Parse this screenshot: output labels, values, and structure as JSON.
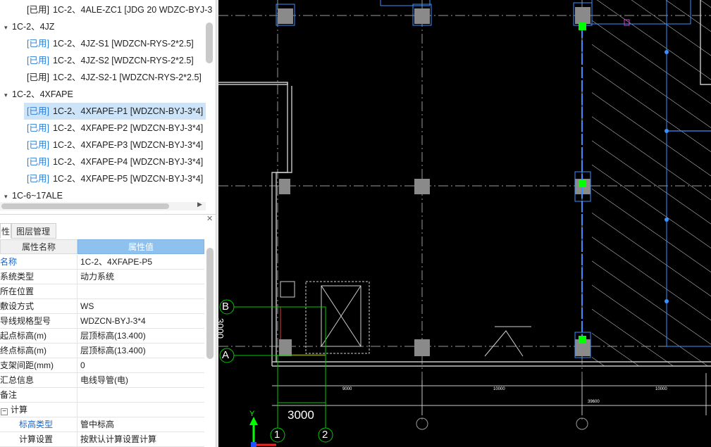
{
  "tree": {
    "rows": [
      {
        "kind": "leaf",
        "tag": "[已用]",
        "tag_color": "black",
        "label": "1C-2、4ALE-ZC1 [JDG 20 WDZC-BYJ-3"
      },
      {
        "kind": "group",
        "label": "1C-2、4JZ"
      },
      {
        "kind": "leaf",
        "tag": "[已用]",
        "tag_color": "blue",
        "label": "1C-2、4JZ-S1 [WDZCN-RYS-2*2.5]"
      },
      {
        "kind": "leaf",
        "tag": "[已用]",
        "tag_color": "blue",
        "label": "1C-2、4JZ-S2 [WDZCN-RYS-2*2.5]"
      },
      {
        "kind": "leaf",
        "tag": "[已用]",
        "tag_color": "black",
        "label": "1C-2、4JZ-S2-1 [WDZCN-RYS-2*2.5]"
      },
      {
        "kind": "group",
        "label": "1C-2、4XFAPE"
      },
      {
        "kind": "leaf",
        "tag": "[已用]",
        "tag_color": "blue",
        "label": "1C-2、4XFAPE-P1 [WDZCN-BYJ-3*4]",
        "selected": true
      },
      {
        "kind": "leaf",
        "tag": "[已用]",
        "tag_color": "blue",
        "label": "1C-2、4XFAPE-P2 [WDZCN-BYJ-3*4]"
      },
      {
        "kind": "leaf",
        "tag": "[已用]",
        "tag_color": "blue",
        "label": "1C-2、4XFAPE-P3 [WDZCN-BYJ-3*4]"
      },
      {
        "kind": "leaf",
        "tag": "[已用]",
        "tag_color": "blue",
        "label": "1C-2、4XFAPE-P4 [WDZCN-BYJ-3*4]"
      },
      {
        "kind": "leaf",
        "tag": "[已用]",
        "tag_color": "blue",
        "label": "1C-2、4XFAPE-P5 [WDZCN-BYJ-3*4]"
      },
      {
        "kind": "group",
        "label": "1C-6~17ALE"
      }
    ]
  },
  "properties": {
    "tabs": {
      "props": "性",
      "layers": "图层管理"
    },
    "header": {
      "name": "属性名称",
      "value": "属性值"
    },
    "rows": [
      {
        "name": "名称",
        "value": "1C-2、4XFAPE-P5",
        "blue": true
      },
      {
        "name": "系统类型",
        "value": "动力系统"
      },
      {
        "name": "所在位置",
        "value": ""
      },
      {
        "name": "敷设方式",
        "value": "WS"
      },
      {
        "name": "导线规格型号",
        "value": "WDZCN-BYJ-3*4"
      },
      {
        "name": "起点标高(m)",
        "value": "层顶标高(13.400)"
      },
      {
        "name": "终点标高(m)",
        "value": "层顶标高(13.400)"
      },
      {
        "name": "支架间距(mm)",
        "value": "0"
      },
      {
        "name": "汇总信息",
        "value": "电线导管(电)"
      },
      {
        "name": "备注",
        "value": ""
      },
      {
        "name": "计算",
        "value": "",
        "group": true
      },
      {
        "name": "标高类型",
        "value": "管中标高",
        "blue": true,
        "indent": true
      },
      {
        "name": "计算设置",
        "value": "按默认计算设置计算",
        "indent": true
      }
    ]
  },
  "cad": {
    "axis_labels": {
      "b": "B",
      "a": "A",
      "one": "1",
      "two": "2"
    },
    "dim_main": "3000",
    "dim_side": "3000",
    "dims_bottom": [
      "9000",
      "10000",
      "10000"
    ],
    "dim_total": "39600",
    "ucs": {
      "y": "Y"
    },
    "colors": {
      "background": "#000000",
      "wire": "#3d8fff",
      "equip": "#00ff00",
      "grid": "#bfbfbf",
      "column": "#8a8a8a"
    }
  }
}
